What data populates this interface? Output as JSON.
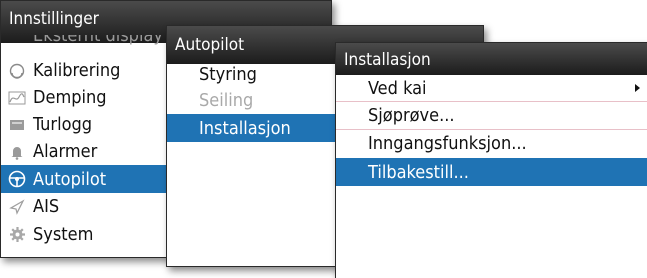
{
  "panel1": {
    "title": "Innstillinger",
    "partial_item": "Eksternt display",
    "items": [
      {
        "label": "Kalibrering",
        "icon": "calibration-icon"
      },
      {
        "label": "Demping",
        "icon": "damping-icon"
      },
      {
        "label": "Turlogg",
        "icon": "triplog-icon"
      },
      {
        "label": "Alarmer",
        "icon": "bell-icon"
      },
      {
        "label": "Autopilot",
        "icon": "steering-wheel-icon"
      },
      {
        "label": "AIS",
        "icon": "ais-icon"
      },
      {
        "label": "System",
        "icon": "gear-icon"
      }
    ],
    "selected": "Autopilot"
  },
  "panel2": {
    "title": "Autopilot",
    "items": [
      {
        "label": "Styring"
      },
      {
        "label": "Seiling"
      },
      {
        "label": "Installasjon"
      }
    ],
    "selected": "Installasjon",
    "disabled": "Seiling"
  },
  "panel3": {
    "title": "Installasjon",
    "items": [
      {
        "label": "Ved kai"
      },
      {
        "label": "Sjøprøve..."
      },
      {
        "label": "Inngangsfunksjon..."
      },
      {
        "label": "Tilbakestill..."
      }
    ],
    "selected": "Tilbakestill...",
    "submenu": "Ved kai"
  },
  "colors": {
    "selection": "#1f73b4",
    "header_dark": "#1c1c1c",
    "separator": "#e8c0c8",
    "disabled_text": "#a9a9a9"
  }
}
